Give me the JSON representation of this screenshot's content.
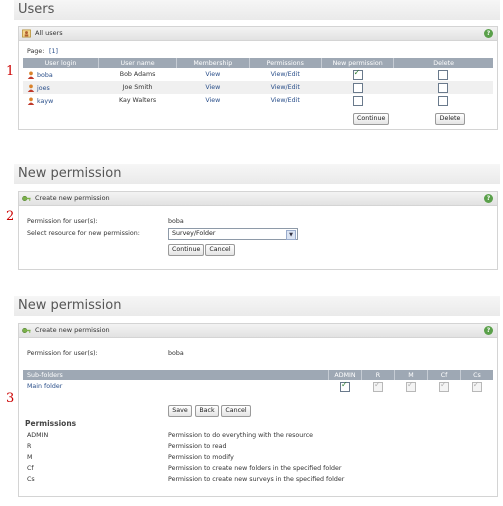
{
  "section1": {
    "number": "1",
    "page_title": "Users",
    "panel_title": "All users",
    "pager_label": "Page:",
    "pager_value": "[1]",
    "columns": [
      "User login",
      "User name",
      "Membership",
      "Permissions",
      "New permission",
      "Delete"
    ],
    "rows": [
      {
        "login": "boba",
        "name": "Bob Adams",
        "membership": "View",
        "permissions": "View/Edit",
        "new_permission": true,
        "delete": false
      },
      {
        "login": "joes",
        "name": "Joe Smith",
        "membership": "View",
        "permissions": "View/Edit",
        "new_permission": false,
        "delete": false
      },
      {
        "login": "kayw",
        "name": "Kay Walters",
        "membership": "View",
        "permissions": "View/Edit",
        "new_permission": false,
        "delete": false
      }
    ],
    "continue_label": "Continue",
    "delete_label": "Delete"
  },
  "section2": {
    "number": "2",
    "page_title": "New permission",
    "panel_title": "Create new permission",
    "for_users_label": "Permission for user(s):",
    "for_users_value": "boba",
    "select_label": "Select resource for new permission:",
    "select_value": "Survey/Folder",
    "continue_label": "Continue",
    "cancel_label": "Cancel"
  },
  "section3": {
    "number": "3",
    "page_title": "New permission",
    "panel_title": "Create new permission",
    "for_users_label": "Permission for user(s):",
    "for_users_value": "boba",
    "columns": [
      "Sub-folders",
      "ADMIN",
      "R",
      "M",
      "Cf",
      "Cs"
    ],
    "folder_row": {
      "name": "Main folder",
      "admin": true,
      "r": true,
      "m": true,
      "cf": true,
      "cs": true
    },
    "save_label": "Save",
    "back_label": "Back",
    "cancel_label": "Cancel",
    "legend_title": "Permissions",
    "legend": [
      {
        "code": "ADMIN",
        "desc": "Permission to do everything with the resource"
      },
      {
        "code": "R",
        "desc": "Permission to read"
      },
      {
        "code": "M",
        "desc": "Permission to modify"
      },
      {
        "code": "Cf",
        "desc": "Permission to create new folders in the specified folder"
      },
      {
        "code": "Cs",
        "desc": "Permission to create new surveys in the specified folder"
      }
    ]
  },
  "colors": {
    "header_row": "#9ea8b4",
    "link": "#2a4f8a",
    "step_number": "#cc0000",
    "help_icon": "#5aa04a"
  },
  "icons": [
    "users-icon",
    "help-icon",
    "user-icon",
    "key-icon",
    "select-arrow-icon",
    "checkmark-icon"
  ]
}
